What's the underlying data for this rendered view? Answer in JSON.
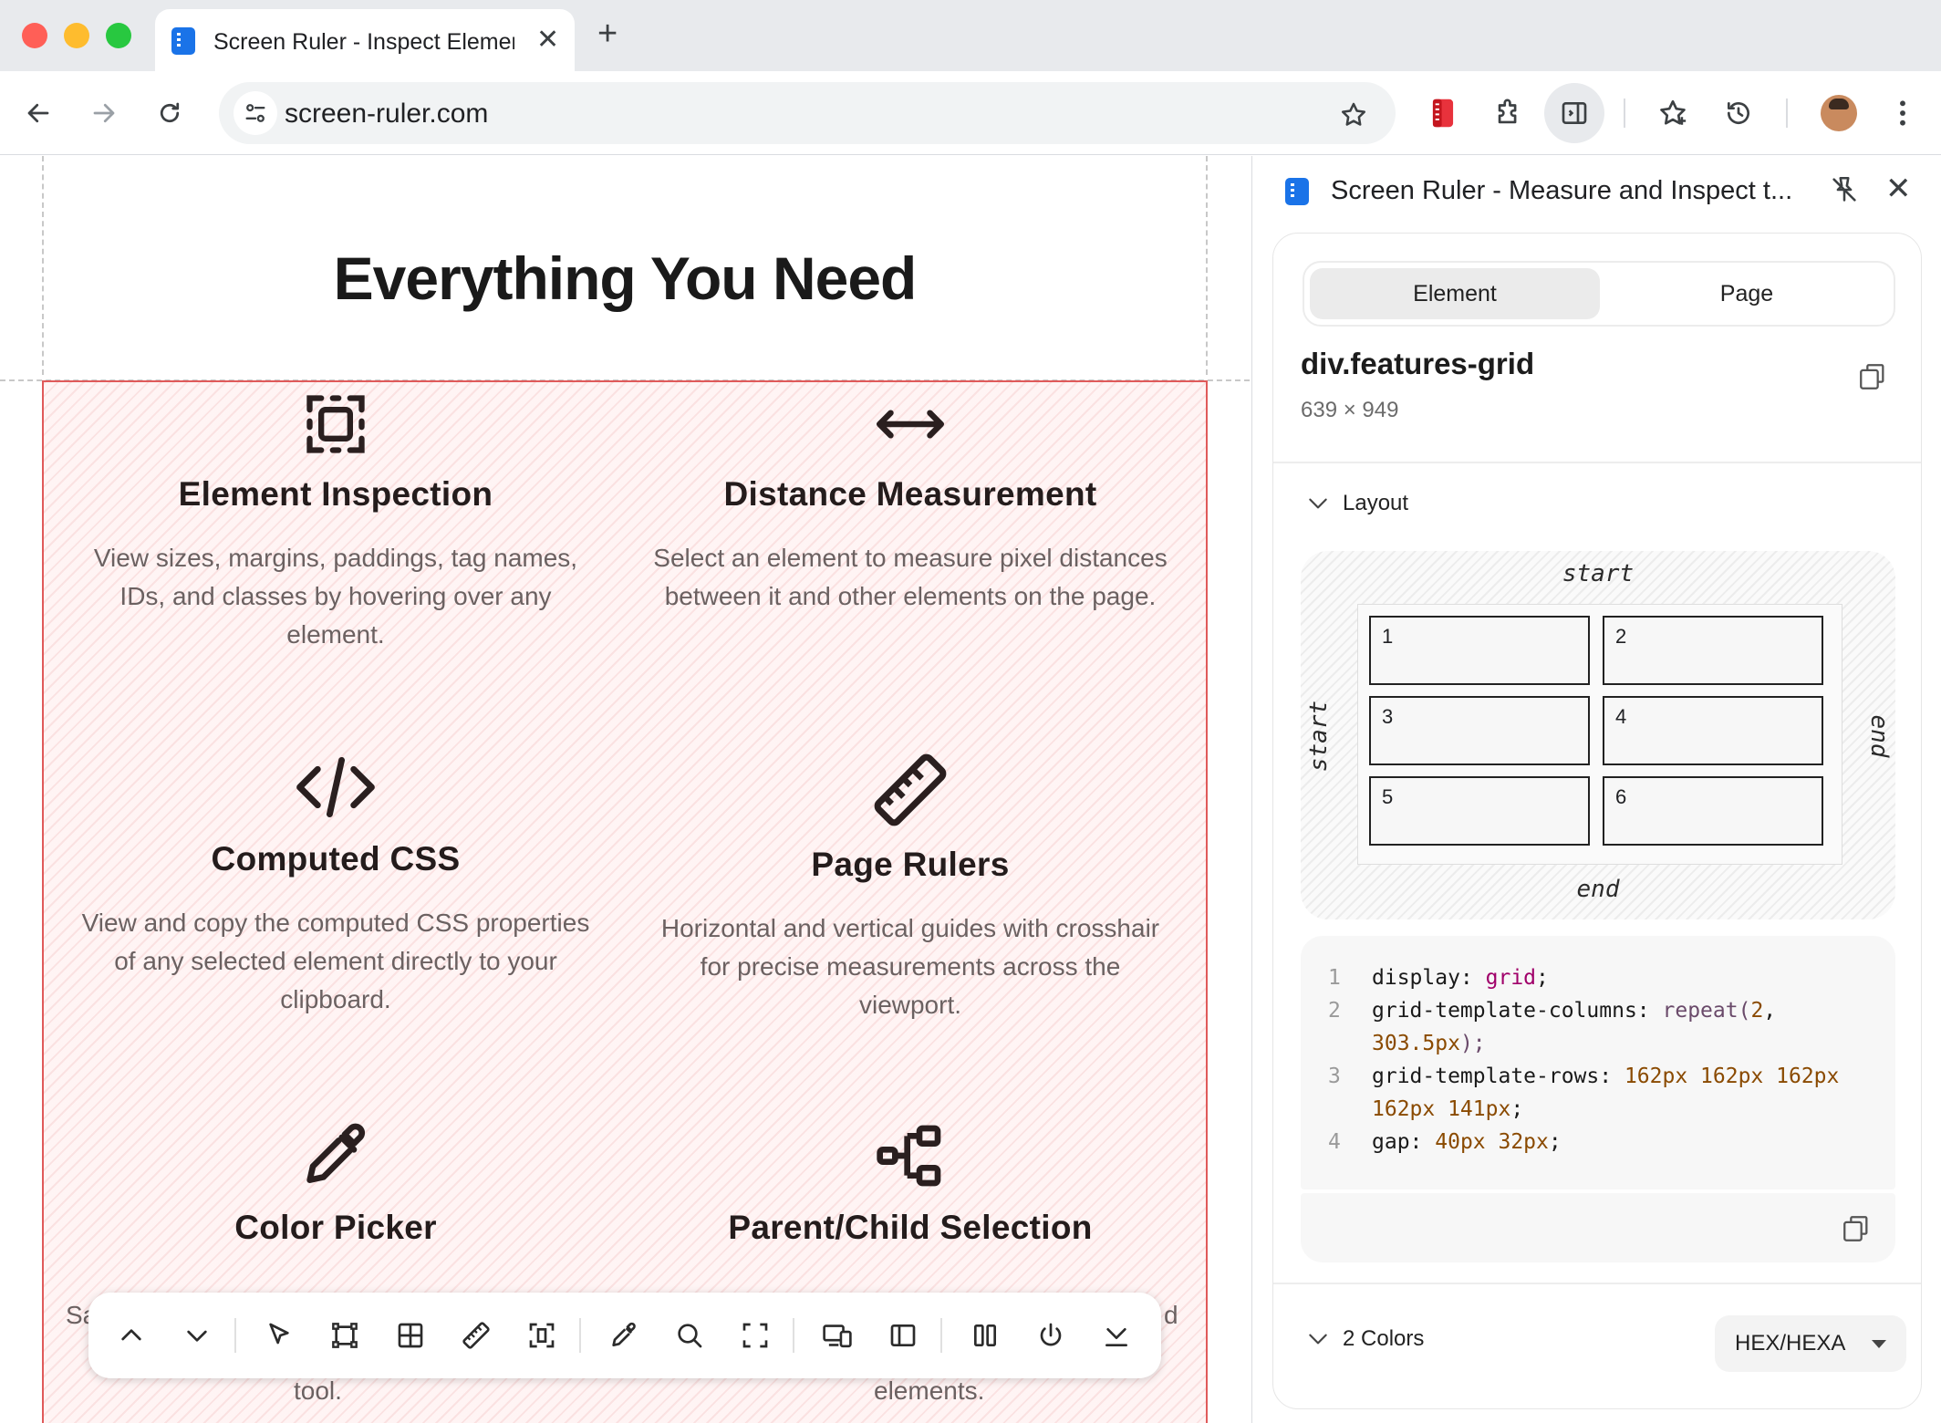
{
  "browser": {
    "tab_title": "Screen Ruler - Inspect Elements",
    "url": "screen-ruler.com",
    "icons": [
      "back-icon",
      "forward-icon",
      "reload-icon",
      "tune-icon",
      "star-icon",
      "ruler-extension-icon",
      "puzzle-icon",
      "side-panel-icon",
      "reading-list-icon",
      "history-icon",
      "avatar",
      "more-icon"
    ]
  },
  "page": {
    "heading": "Everything You Need",
    "features": [
      {
        "title": "Element Inspection",
        "desc": "View sizes, margins, paddings, tag names, IDs, and classes by hovering over any element.",
        "icon": "select-box-icon"
      },
      {
        "title": "Distance Measurement",
        "desc": "Select an element to measure pixel distances between it and other elements on the page.",
        "icon": "double-arrow-icon"
      },
      {
        "title": "Computed CSS",
        "desc": "View and copy the computed CSS properties of any selected element directly to your clipboard.",
        "icon": "code-icon"
      },
      {
        "title": "Page Rulers",
        "desc": "Horizontal and vertical guides with crosshair for precise measurements across the viewport.",
        "icon": "ruler-icon"
      },
      {
        "title": "Color Picker",
        "icon": "eyedropper-icon"
      },
      {
        "title": "Parent/Child Selection",
        "icon": "hierarchy-icon"
      }
    ],
    "peek_left": "Sa",
    "peek_right": "d",
    "peek_bottom_left": "tool.",
    "peek_bottom_right": "elements."
  },
  "panel": {
    "title": "Screen Ruler - Measure and Inspect t...",
    "tabs": [
      "Element",
      "Page"
    ],
    "active_tab": "Element",
    "selector": "div.features-grid",
    "size": "639 × 949",
    "layout_label": "Layout",
    "diagram": {
      "top": "start",
      "bottom": "end",
      "left": "start",
      "right": "end",
      "cells": [
        "1",
        "2",
        "3",
        "4",
        "5",
        "6"
      ]
    },
    "code": {
      "l1": {
        "num": "1",
        "prop": "display: ",
        "val": "grid",
        "end": ";"
      },
      "l2": {
        "num": "2",
        "prop": "grid-template-columns: ",
        "fn": "repeat(",
        "a": "2",
        "sep": ",",
        "b": "303.5px",
        "end": ");"
      },
      "l3": {
        "num": "3",
        "prop": "grid-template-rows: ",
        "a": "162px 162px 162px",
        "b": "162px 141px",
        "end": ";"
      },
      "l4": {
        "num": "4",
        "prop": "gap: ",
        "a": "40px 32px",
        "end": ";"
      }
    },
    "colors_label": "2 Colors",
    "color_format": "HEX/HEXA"
  },
  "colors": {
    "accent": "#1a73e8",
    "highlight": "#e05a5a"
  }
}
